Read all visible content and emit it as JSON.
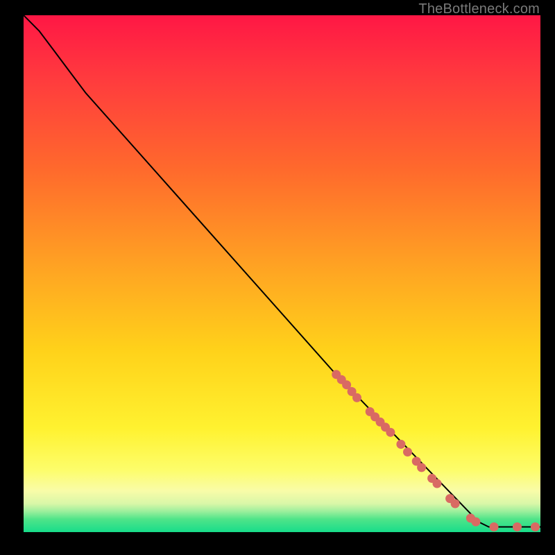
{
  "watermark": "TheBottleneck.com",
  "chart_data": {
    "type": "line",
    "title": "",
    "xlabel": "",
    "ylabel": "",
    "xlim": [
      0,
      100
    ],
    "ylim": [
      0,
      100
    ],
    "curve": [
      {
        "x": 0,
        "y": 100
      },
      {
        "x": 3,
        "y": 97
      },
      {
        "x": 6,
        "y": 93
      },
      {
        "x": 9,
        "y": 89
      },
      {
        "x": 12,
        "y": 85
      },
      {
        "x": 60,
        "y": 31
      },
      {
        "x": 88,
        "y": 2
      },
      {
        "x": 90,
        "y": 1
      },
      {
        "x": 100,
        "y": 1
      }
    ],
    "markers": [
      {
        "x": 60.5,
        "y": 30.5
      },
      {
        "x": 61.5,
        "y": 29.5
      },
      {
        "x": 62.5,
        "y": 28.5
      },
      {
        "x": 63.5,
        "y": 27.2
      },
      {
        "x": 64.5,
        "y": 26.0
      },
      {
        "x": 67.0,
        "y": 23.3
      },
      {
        "x": 68.0,
        "y": 22.3
      },
      {
        "x": 69.0,
        "y": 21.3
      },
      {
        "x": 70.0,
        "y": 20.3
      },
      {
        "x": 71.0,
        "y": 19.3
      },
      {
        "x": 73.0,
        "y": 17.0
      },
      {
        "x": 74.3,
        "y": 15.5
      },
      {
        "x": 76.0,
        "y": 13.7
      },
      {
        "x": 77.0,
        "y": 12.5
      },
      {
        "x": 79.0,
        "y": 10.4
      },
      {
        "x": 80.0,
        "y": 9.4
      },
      {
        "x": 82.5,
        "y": 6.5
      },
      {
        "x": 83.5,
        "y": 5.5
      },
      {
        "x": 86.5,
        "y": 2.7
      },
      {
        "x": 87.5,
        "y": 2.0
      },
      {
        "x": 91.0,
        "y": 1.0
      },
      {
        "x": 95.5,
        "y": 1.0
      },
      {
        "x": 99.0,
        "y": 1.0
      }
    ],
    "colors": {
      "curve": "#000000",
      "marker": "#d96a63"
    }
  }
}
